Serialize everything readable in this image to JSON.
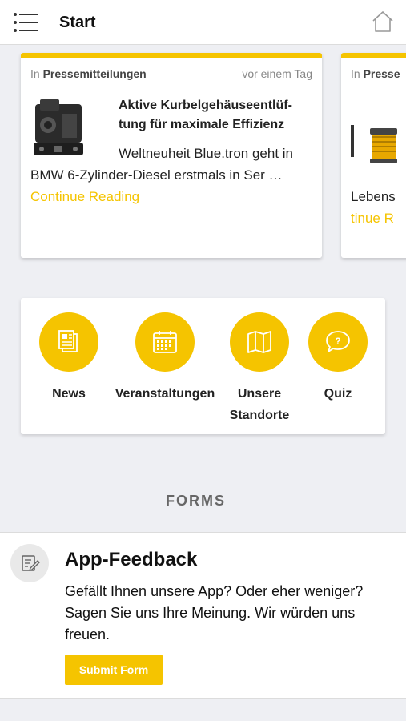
{
  "header": {
    "title": "Start"
  },
  "carousel": {
    "cards": [
      {
        "prefix": "In",
        "category": "Pressemitteilungen",
        "date": "vor einem Tag",
        "title": "Aktive Kurbelgehäuseentlüf­tung für maximale Effizienz",
        "excerpt": "Weltneuheit Blue.tron geht in BMW 6-Zylinder-Diesel erst­mals in Ser …",
        "more": "Continue Reading"
      },
      {
        "prefix": "In",
        "category": "Presse",
        "excerpt": "Lebens",
        "more": "tinue R"
      }
    ]
  },
  "quick_links": [
    {
      "label": "News",
      "icon": "news-icon"
    },
    {
      "label": "Veranstaltungen",
      "icon": "calendar-icon"
    },
    {
      "label": "Unsere Standorte",
      "icon": "map-icon"
    },
    {
      "label": "Quiz",
      "icon": "quiz-icon"
    }
  ],
  "forms": {
    "heading": "FORMS",
    "items": [
      {
        "title": "App-Feedback",
        "description": "Gefällt Ihnen unsere App? Oder eher weniger? Sagen Sie uns Ihre Meinung. Wir würden uns freuen.",
        "button": "Submit Form",
        "icon": "form-edit-icon"
      }
    ]
  },
  "colors": {
    "accent": "#f5c400",
    "background": "#eeeff3"
  }
}
